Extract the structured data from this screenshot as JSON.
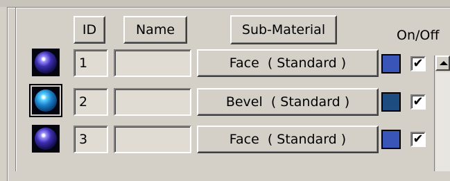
{
  "headers": {
    "id": "ID",
    "name": "Name",
    "sub_material": "Sub-Material",
    "on_off": "On/Off"
  },
  "rows": [
    {
      "id": "1",
      "name": "",
      "sub_material": "Face  ( Standard )",
      "color": "#3a55b8",
      "checked": "✔",
      "thumb": "dark-sphere",
      "selected": false
    },
    {
      "id": "2",
      "name": "",
      "sub_material": "Bevel  ( Standard )",
      "color": "#1c4c80",
      "checked": "✔",
      "thumb": "blue-sphere",
      "selected": true
    },
    {
      "id": "3",
      "name": "",
      "sub_material": "Face  ( Standard )",
      "color": "#3a55b8",
      "checked": "✔",
      "thumb": "dark-sphere",
      "selected": false
    }
  ]
}
